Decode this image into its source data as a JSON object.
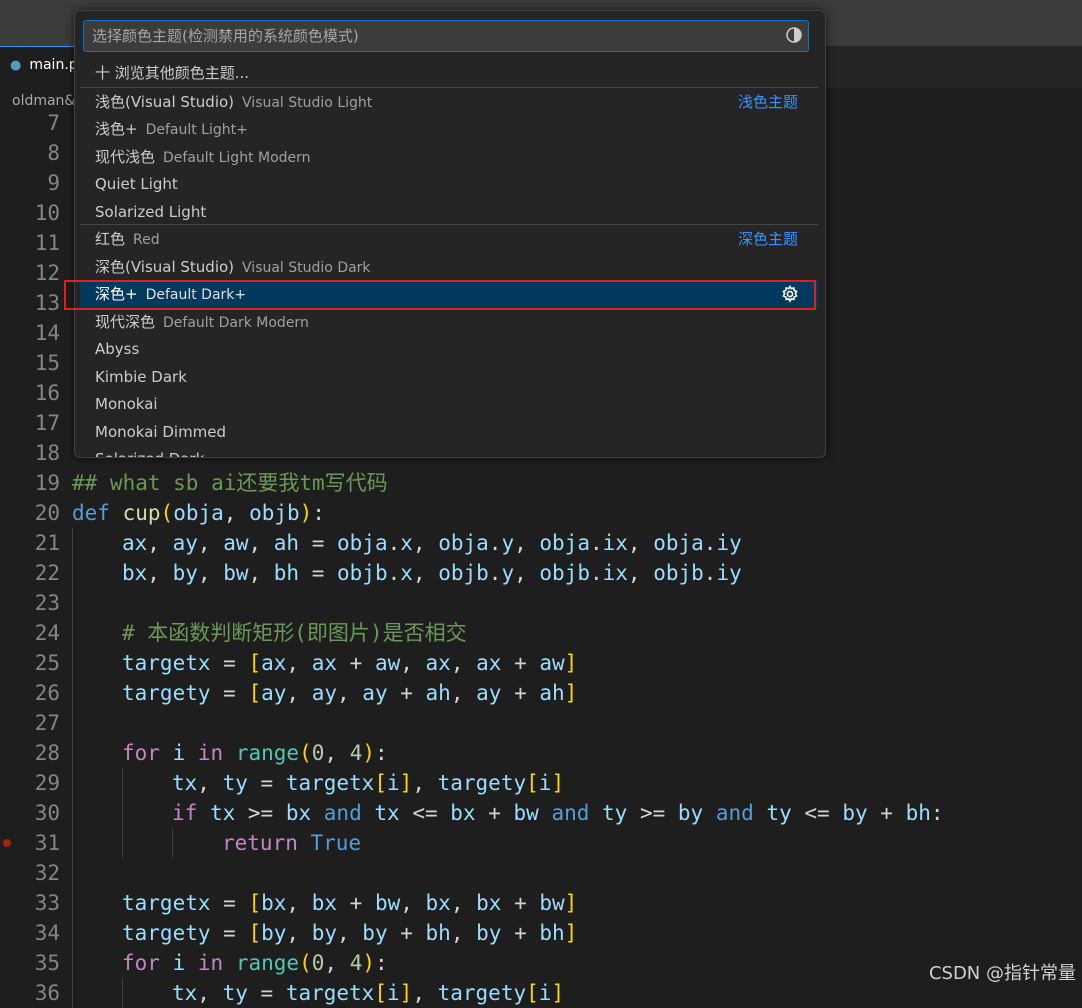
{
  "tab": {
    "label": "main.py"
  },
  "breadcrumb": {
    "text": "oldman&"
  },
  "quickpick": {
    "placeholder": "选择颜色主题(检测禁用的系统颜色模式)",
    "browse_label": "十 浏览其他颜色主题...",
    "light_group": "浅色主题",
    "dark_group": "深色主题",
    "items": [
      {
        "label": "浅色(Visual Studio)",
        "desc": "Visual Studio Light"
      },
      {
        "label": "浅色+",
        "desc": "Default Light+"
      },
      {
        "label": "现代浅色",
        "desc": "Default Light Modern"
      },
      {
        "label": "Quiet Light",
        "desc": ""
      },
      {
        "label": "Solarized Light",
        "desc": ""
      },
      {
        "label": "红色",
        "desc": "Red"
      },
      {
        "label": "深色(Visual Studio)",
        "desc": "Visual Studio Dark"
      },
      {
        "label": "深色+",
        "desc": "Default Dark+"
      },
      {
        "label": "现代深色",
        "desc": "Default Dark Modern"
      },
      {
        "label": "Abyss",
        "desc": ""
      },
      {
        "label": "Kimbie Dark",
        "desc": ""
      },
      {
        "label": "Monokai",
        "desc": ""
      },
      {
        "label": "Monokai Dimmed",
        "desc": ""
      },
      {
        "label": "Solarized Dark",
        "desc": ""
      }
    ]
  },
  "line_numbers": [
    "7",
    "8",
    "9",
    "10",
    "11",
    "12",
    "13",
    "14",
    "15",
    "16",
    "17",
    "18",
    "19",
    "20",
    "21",
    "22",
    "23",
    "24",
    "25",
    "26",
    "27",
    "28",
    "29",
    "30",
    "31",
    "32",
    "33",
    "34",
    "35",
    "36"
  ],
  "code": {
    "l19": "## what sb ai还要我tm写代码",
    "l24": "# 本函数判断矩形(即图片)是否相交"
  },
  "colors": {
    "editor_bg": "#1e1e1e",
    "accent": "#0078d4",
    "selection": "#04395e",
    "annotation_box": "#e02020"
  },
  "watermark": "CSDN @指针常量"
}
